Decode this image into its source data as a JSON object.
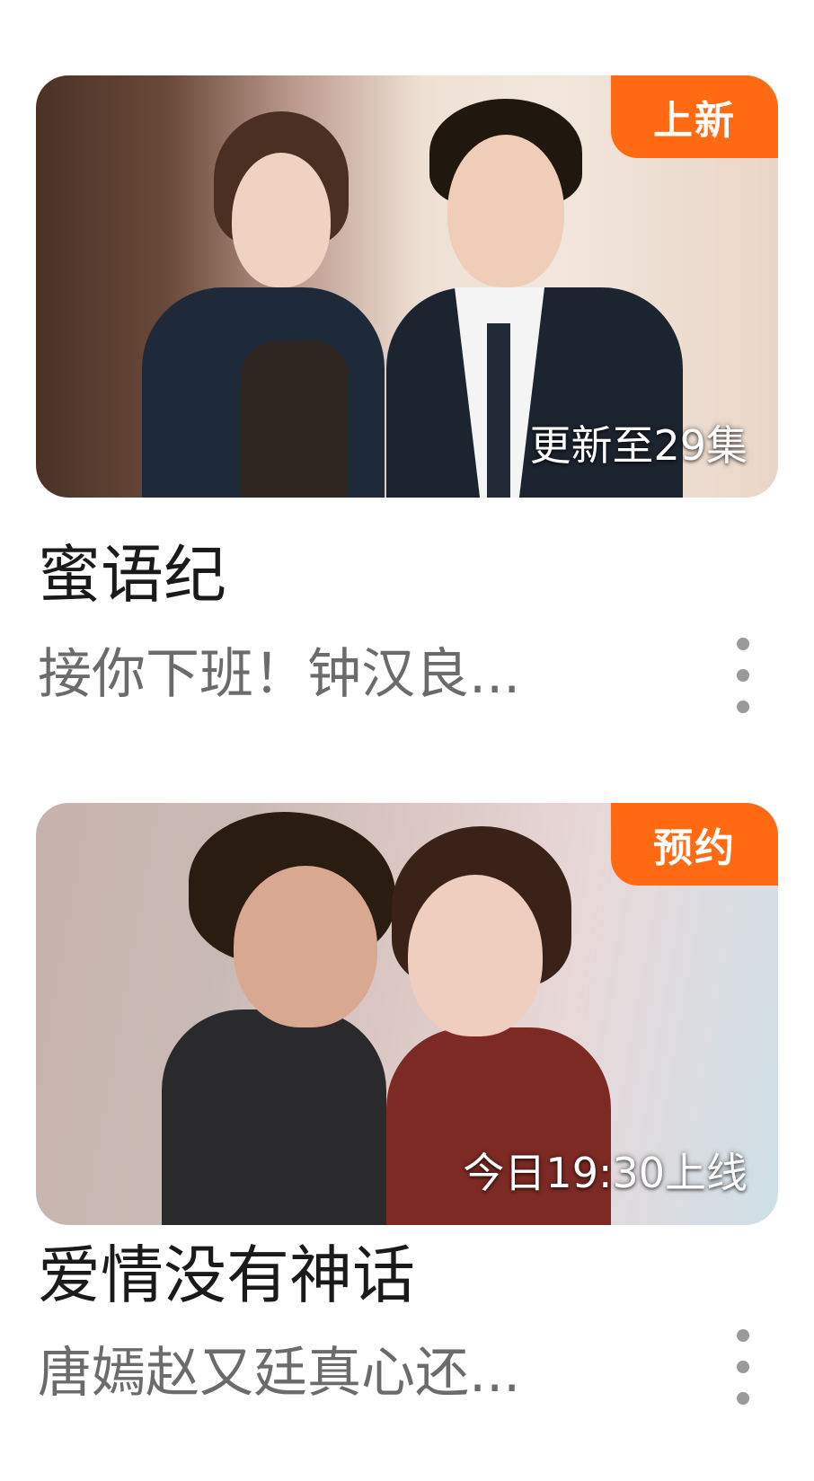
{
  "items": [
    {
      "badge": "上新",
      "overlay": "更新至29集",
      "title": "蜜语纪",
      "subtitle": "接你下班！钟汉良...",
      "badge_color": "#ff6a13"
    },
    {
      "badge": "预约",
      "overlay": "今日19:30上线",
      "title": "爱情没有神话",
      "subtitle": "唐嫣赵又廷真心还...",
      "badge_color": "#ff6a13"
    }
  ],
  "icons": {
    "more": "more-vertical-icon"
  }
}
